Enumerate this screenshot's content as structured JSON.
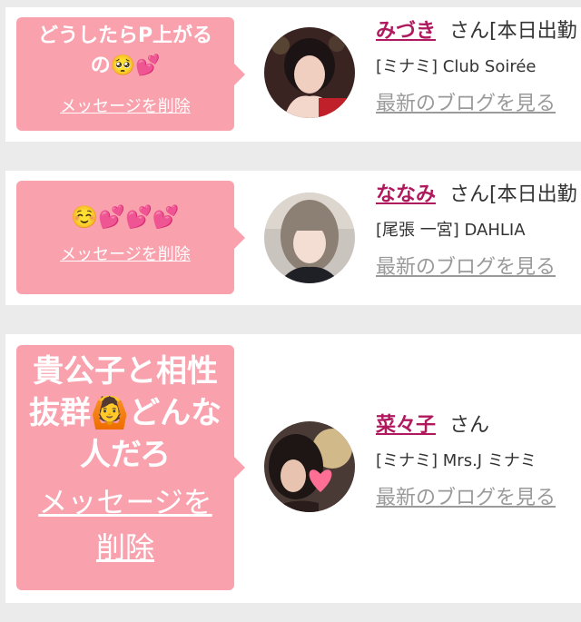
{
  "colors": {
    "bubble": "#f9a2ae",
    "name": "#b0195e",
    "blog_link": "#9a9a9a",
    "card": "#ffffff",
    "background": "#ebebeb"
  },
  "items": [
    {
      "message": "どうしたらP上がるの🥺💕",
      "delete_label": "メッセージを削除",
      "name": "みづき",
      "honorific": "さん",
      "status": "[本日出勤",
      "shop": "[ミナミ] Club Soirée",
      "blog_label": "最新のブログを見る"
    },
    {
      "message": "☺️💕💕💕",
      "delete_label": "メッセージを削除",
      "name": "ななみ",
      "honorific": "さん",
      "status": "[本日出勤",
      "shop": "[尾張 一宮] DAHLIA",
      "blog_label": "最新のブログを見る"
    },
    {
      "message": "貴公子と相性抜群🙆どんな人だろ",
      "delete_label": "メッセージを削除",
      "name": "菜々子",
      "honorific": "さん",
      "status": "",
      "shop": "[ミナミ] Mrs.J ミナミ",
      "blog_label": "最新のブログを見る"
    }
  ]
}
